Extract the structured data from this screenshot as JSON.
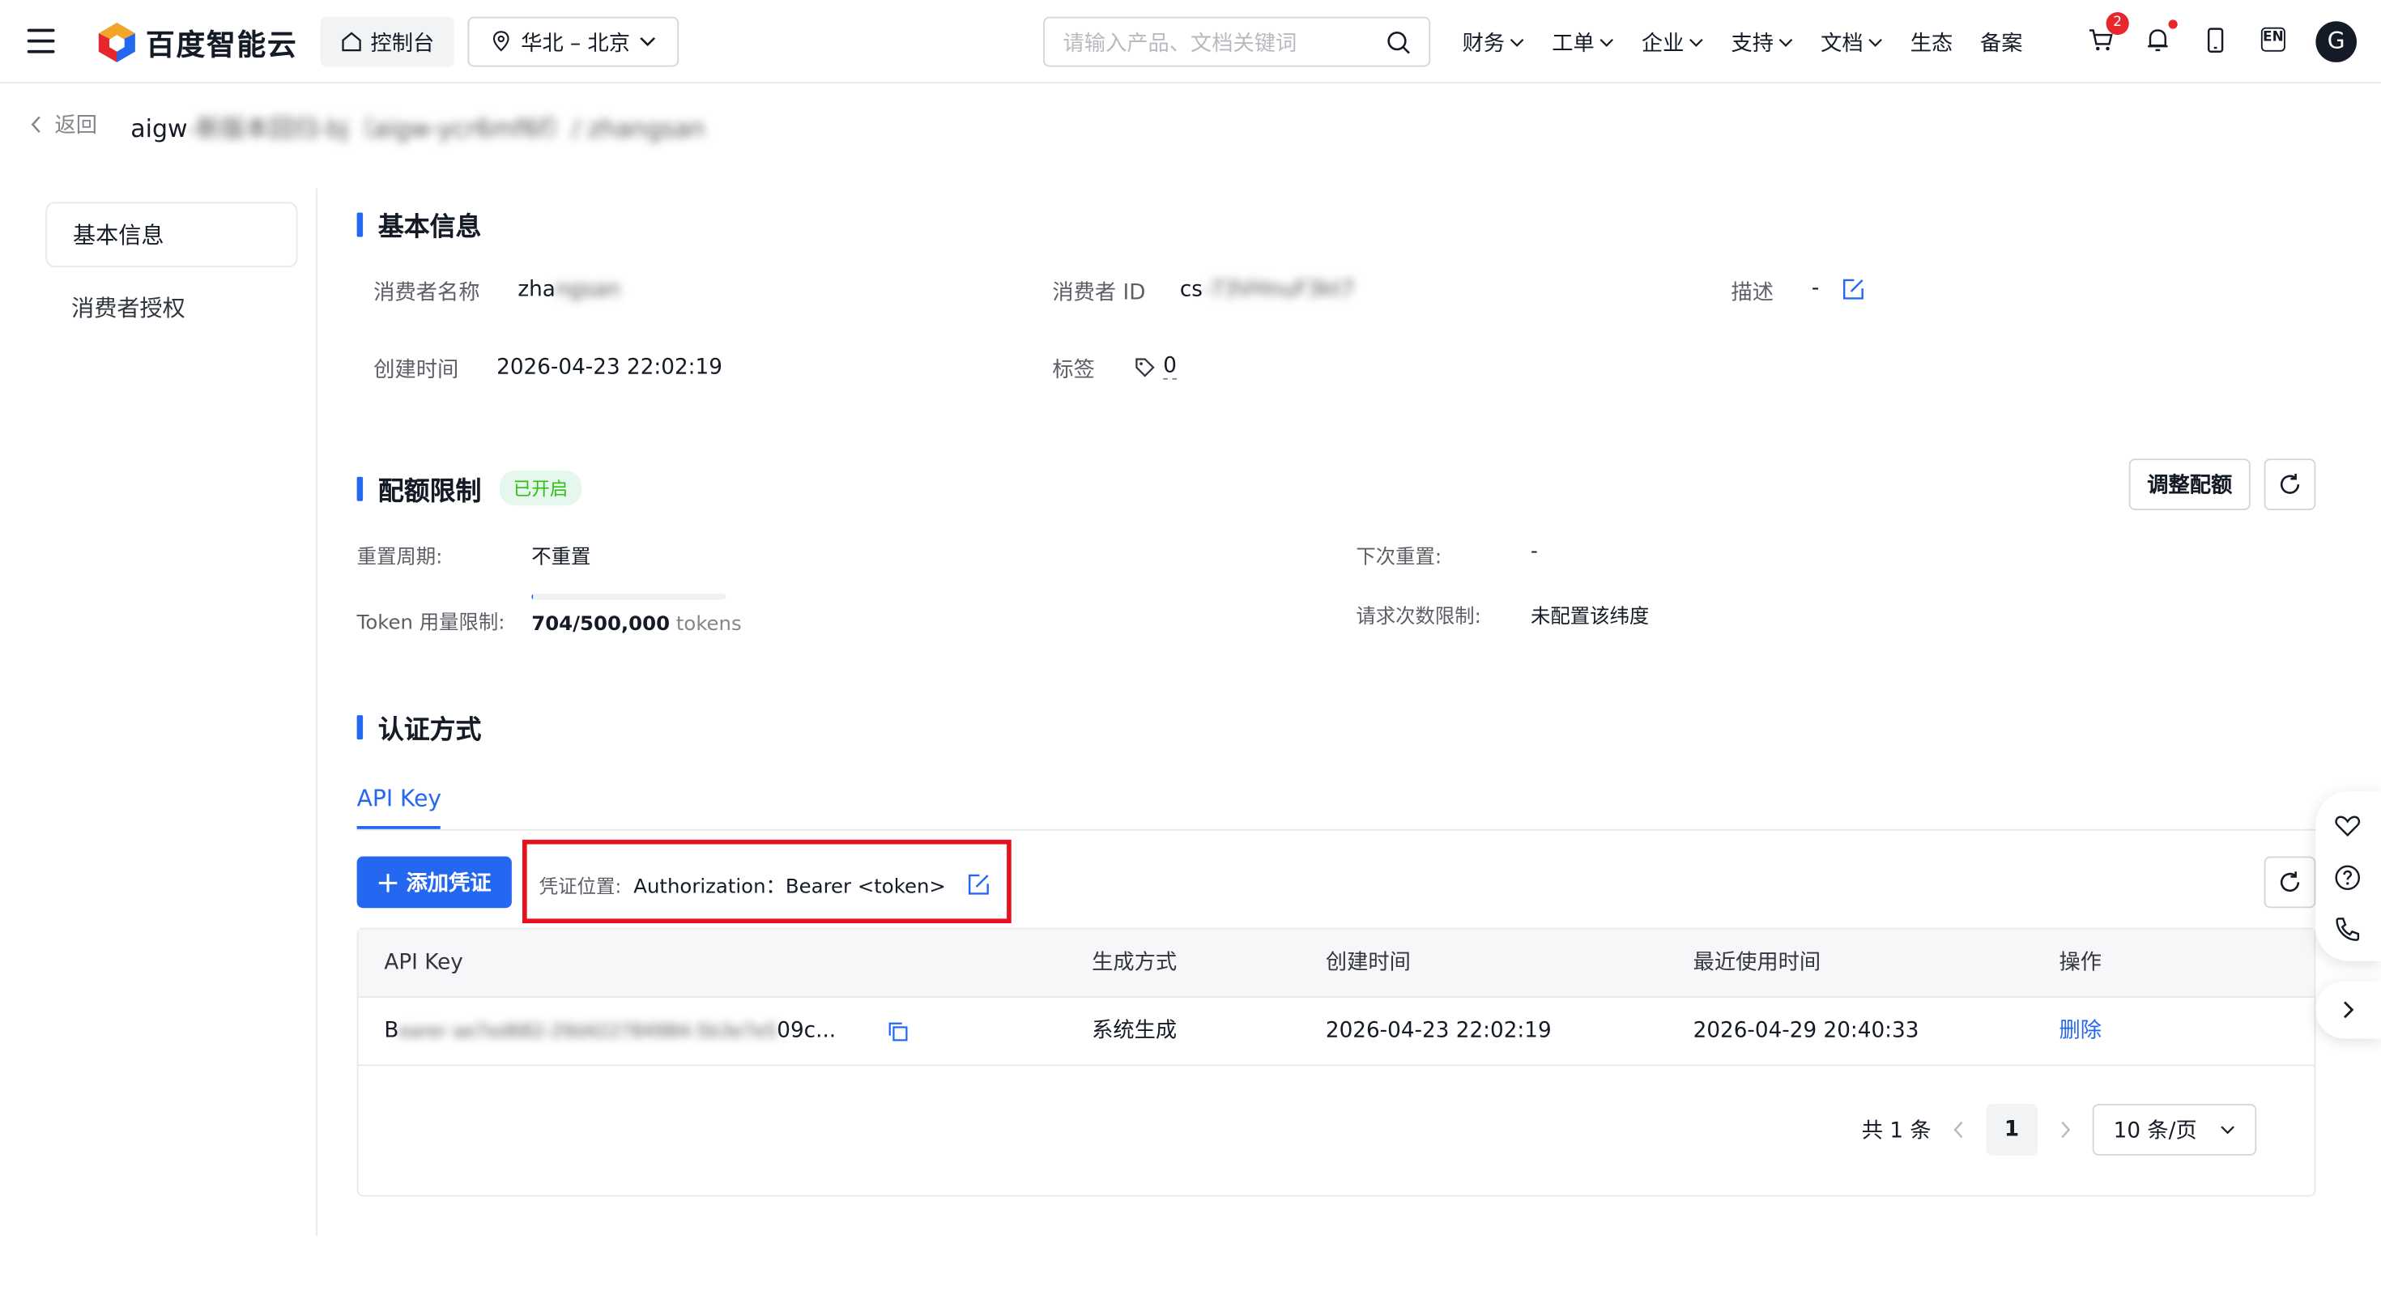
{
  "header": {
    "brand": "百度智能云",
    "console": "控制台",
    "region": "华北 – 北京",
    "search_placeholder": "请输入产品、文档关键词",
    "nav": [
      "财务",
      "工单",
      "企业",
      "支持",
      "文档",
      "生态",
      "备案"
    ],
    "cart_badge": "2",
    "lang": "EN",
    "avatar": "G"
  },
  "breadcrumb": {
    "back": "返回",
    "title_prefix": "aigw",
    "title_blurred": "-新版本回归-bj（aigw-ycr6mf6f）/ zhangsan"
  },
  "sidebar": {
    "items": [
      "基本信息",
      "消费者授权"
    ]
  },
  "basic": {
    "title": "基本信息",
    "name_label": "消费者名称",
    "name_visible": "zha",
    "name_blurred": "ngsan",
    "id_label": "消费者 ID",
    "id_visible": "cs",
    "id_blurred": "-73VHnuF3kt7",
    "desc_label": "描述",
    "desc_value": "-",
    "created_label": "创建时间",
    "created_value": "2026-04-23 22:02:19",
    "tag_label": "标签",
    "tag_count": "0"
  },
  "quota": {
    "title": "配额限制",
    "status": "已开启",
    "adjust_button": "调整配额",
    "reset_label": "重置周期:",
    "reset_value": "不重置",
    "next_label": "下次重置:",
    "next_value": "-",
    "token_label": "Token 用量限制:",
    "token_value": "704/500,000",
    "token_unit": "tokens",
    "token_usage_fraction": 0.0014,
    "req_label": "请求次数限制:",
    "req_value": "未配置该纬度"
  },
  "auth": {
    "title": "认证方式",
    "tab": "API Key",
    "add_button": "添加凭证",
    "cred_label": "凭证位置:",
    "cred_value": "Authorization：Bearer <token>",
    "columns": [
      "API Key",
      "生成方式",
      "创建时间",
      "最近使用时间",
      "操作"
    ],
    "rows": [
      {
        "key_visible": "B",
        "key_blurred": "earer ae7ed682-29d422784984-5b3e7e5",
        "key_tail": "09c...",
        "method": "系统生成",
        "created": "2026-04-23 22:02:19",
        "last_used": "2026-04-29 20:40:33",
        "action": "删除"
      }
    ],
    "total": "共 1 条",
    "page": "1",
    "page_size": "10 条/页"
  },
  "colors": {
    "primary": "#2468f2",
    "danger": "#e8101d",
    "success": "#30bf13"
  }
}
